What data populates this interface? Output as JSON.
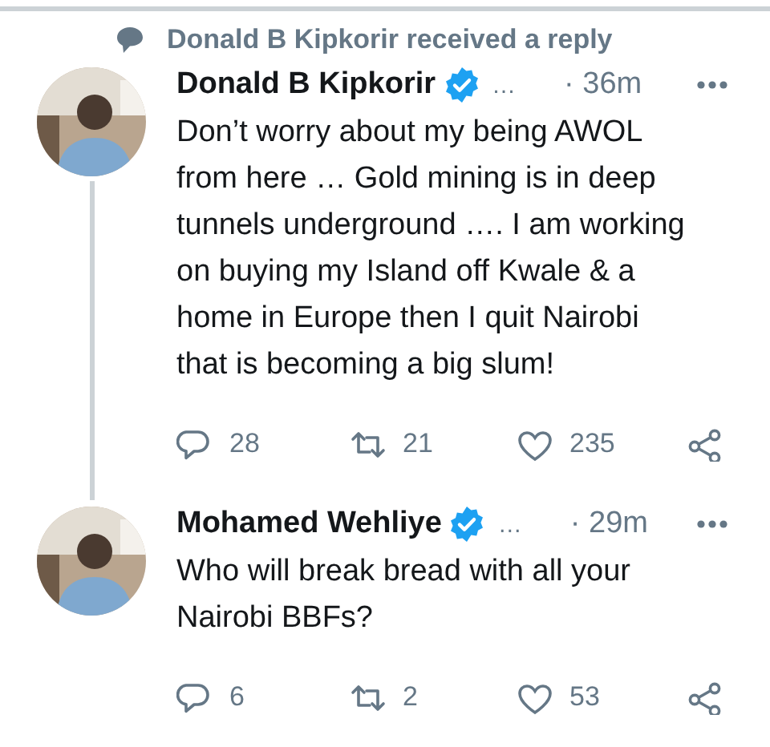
{
  "notification": {
    "text": "Donald B Kipkorir received a reply"
  },
  "tweets": [
    {
      "name": "Donald B Kipkorir",
      "verified": true,
      "handle": "…",
      "time": "· 36m",
      "text": "Don’t worry about my being AWOL from here … Gold mining is in deep tunnels underground …. I am working on buying my Island off Kwale & a home in Europe then I quit Nairobi that is becoming a big slum!",
      "replies": "28",
      "retweets": "21",
      "likes": "235",
      "thread_line": true
    },
    {
      "name": "Mohamed Wehliye",
      "verified": true,
      "handle": "…",
      "time": "· 29m",
      "text": "Who will break bread with all your Nairobi BBFs?",
      "replies": "6",
      "retweets": "2",
      "likes": "53",
      "thread_line": false
    }
  ]
}
